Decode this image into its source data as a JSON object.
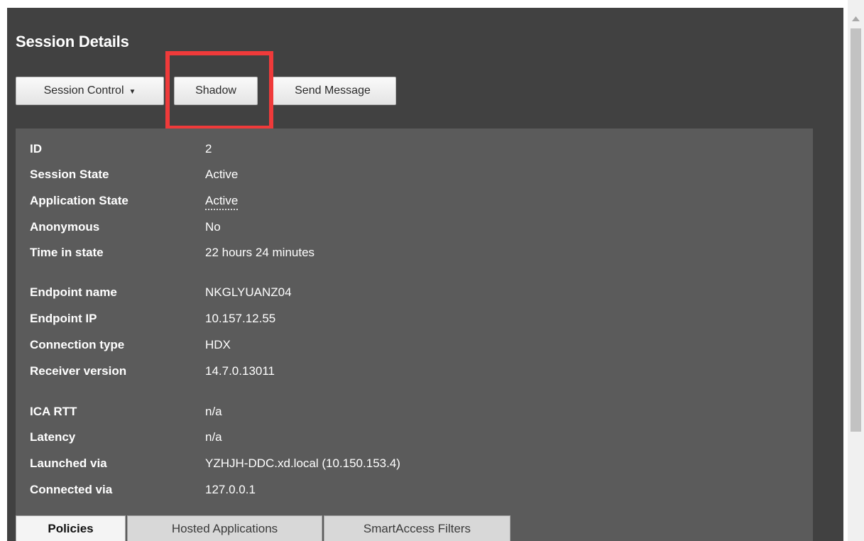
{
  "title": "Session Details",
  "toolbar": {
    "session_control_label": "Session Control",
    "shadow_label": "Shadow",
    "send_message_label": "Send Message"
  },
  "details": {
    "id": {
      "label": "ID",
      "value": "2"
    },
    "session_state": {
      "label": "Session State",
      "value": "Active"
    },
    "application_state": {
      "label": "Application State",
      "value": "Active"
    },
    "anonymous": {
      "label": "Anonymous",
      "value": "No"
    },
    "time_in_state": {
      "label": "Time in state",
      "value": "22 hours 24 minutes"
    },
    "endpoint_name": {
      "label": "Endpoint name",
      "value": "NKGLYUANZ04"
    },
    "endpoint_ip": {
      "label": "Endpoint IP",
      "value": "10.157.12.55"
    },
    "connection_type": {
      "label": "Connection type",
      "value": "HDX"
    },
    "receiver_version": {
      "label": "Receiver version",
      "value": "14.7.0.13011"
    },
    "ica_rtt": {
      "label": "ICA RTT",
      "value": "n/a"
    },
    "latency": {
      "label": "Latency",
      "value": "n/a"
    },
    "launched_via": {
      "label": "Launched via",
      "value": "YZHJH-DDC.xd.local (10.150.153.4)"
    },
    "connected_via": {
      "label": "Connected via",
      "value": "127.0.0.1"
    }
  },
  "tabs": [
    {
      "label": "Policies",
      "active": true
    },
    {
      "label": "Hosted Applications",
      "active": false
    },
    {
      "label": "SmartAccess Filters",
      "active": false
    }
  ],
  "colors": {
    "panel_bg": "#414141",
    "details_bg": "#5b5b5b",
    "highlight": "#ef3a3a"
  },
  "icons": {
    "dropdown": "caret-down-icon",
    "scroll_up": "arrow-up-icon"
  }
}
